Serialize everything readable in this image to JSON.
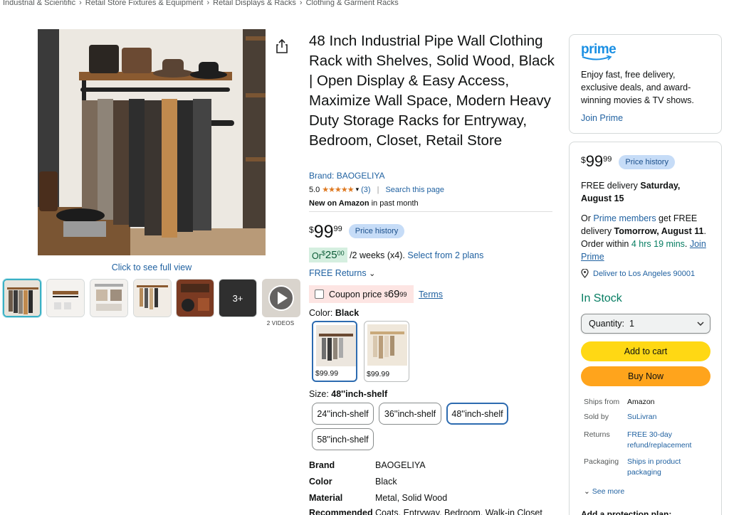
{
  "breadcrumb": [
    "Industrial & Scientific",
    "Retail Store Fixtures & Equipment",
    "Retail Displays & Racks",
    "Clothing & Garment Racks"
  ],
  "breadcrumb_separator": "›",
  "gallery": {
    "full_view": "Click to see full view",
    "more_count": "3+",
    "videos_label": "2 VIDEOS"
  },
  "product": {
    "title": "48 Inch Industrial Pipe Wall Clothing Rack with Shelves, Solid Wood, Black | Open Display & Easy Access, Maximize Wall Space, Modern Heavy Duty Storage Racks for Entryway, Bedroom, Closet, Retail Store",
    "brand_link": "Brand: BAOGELIYA",
    "rating_value": "5.0",
    "stars": "★★★★★",
    "rating_count": "(3)",
    "search_page": "Search this page",
    "new_bold": "New on Amazon",
    "new_rest": " in past month",
    "price_symbol": "$",
    "price_whole": "99",
    "price_fraction": "99",
    "price_history": "Price history",
    "plan_or": "Or ",
    "plan_symbol": "$",
    "plan_whole": "25",
    "plan_fraction": "00",
    "plan_rest": " /2 weeks (x4). ",
    "plan_link": "Select from 2 plans",
    "returns": "FREE Returns",
    "coupon_label": "Coupon price ",
    "coupon_symbol": "$",
    "coupon_whole": "69",
    "coupon_fraction": "99",
    "terms": "Terms",
    "color_label": "Color: ",
    "color_value": "Black",
    "swatches": [
      {
        "price": "$99.99"
      },
      {
        "price": "$99.99"
      }
    ],
    "size_label": "Size: ",
    "size_value": "48''inch-shelf",
    "sizes": [
      "24''inch-shelf",
      "36''inch-shelf",
      "48''inch-shelf",
      "58''inch-shelf"
    ],
    "selected_size_index": 2,
    "specs": [
      {
        "k": "Brand",
        "v": "BAOGELIYA"
      },
      {
        "k": "Color",
        "v": "Black"
      },
      {
        "k": "Material",
        "v": "Metal, Solid Wood"
      },
      {
        "k": "Recommended",
        "v": "Coats, Entryway, Bedroom, Walk-in Closet"
      }
    ]
  },
  "prime": {
    "logo": "prime",
    "text": "Enjoy fast, free delivery, exclusive deals, and award-winning movies & TV shows.",
    "join": "Join Prime"
  },
  "buybox": {
    "price_symbol": "$",
    "price_whole": "99",
    "price_fraction": "99",
    "price_history": "Price history",
    "delivery_prefix": "FREE delivery ",
    "delivery_date": "Saturday, August 15",
    "or_text": "Or ",
    "prime_members": "Prime members",
    "get_free": " get FREE delivery ",
    "fast_date": "Tomorrow, August 11",
    "order_within": ". Order within ",
    "countdown": "4 hrs 19 mins",
    "join_prime": "Join Prime",
    "deliver_to": "Deliver to Los Angeles 90001",
    "in_stock": "In Stock",
    "quantity": "Quantity:  1",
    "add_to_cart": "Add to cart",
    "buy_now": "Buy Now",
    "ships_from_k": "Ships from",
    "ships_from_v": "Amazon",
    "sold_by_k": "Sold by",
    "sold_by_v": "SuLivran",
    "returns_k": "Returns",
    "returns_v": "FREE 30-day refund/replacement",
    "packaging_k": "Packaging",
    "packaging_v": "Ships in product packaging",
    "see_more": "See more",
    "protection": "Add a protection plan:"
  },
  "colors": {
    "link": "#2162a1",
    "cart": "#ffd814",
    "buy": "#ffa41c",
    "in_stock": "#067d62",
    "selected_border": "#2d6bb0"
  }
}
